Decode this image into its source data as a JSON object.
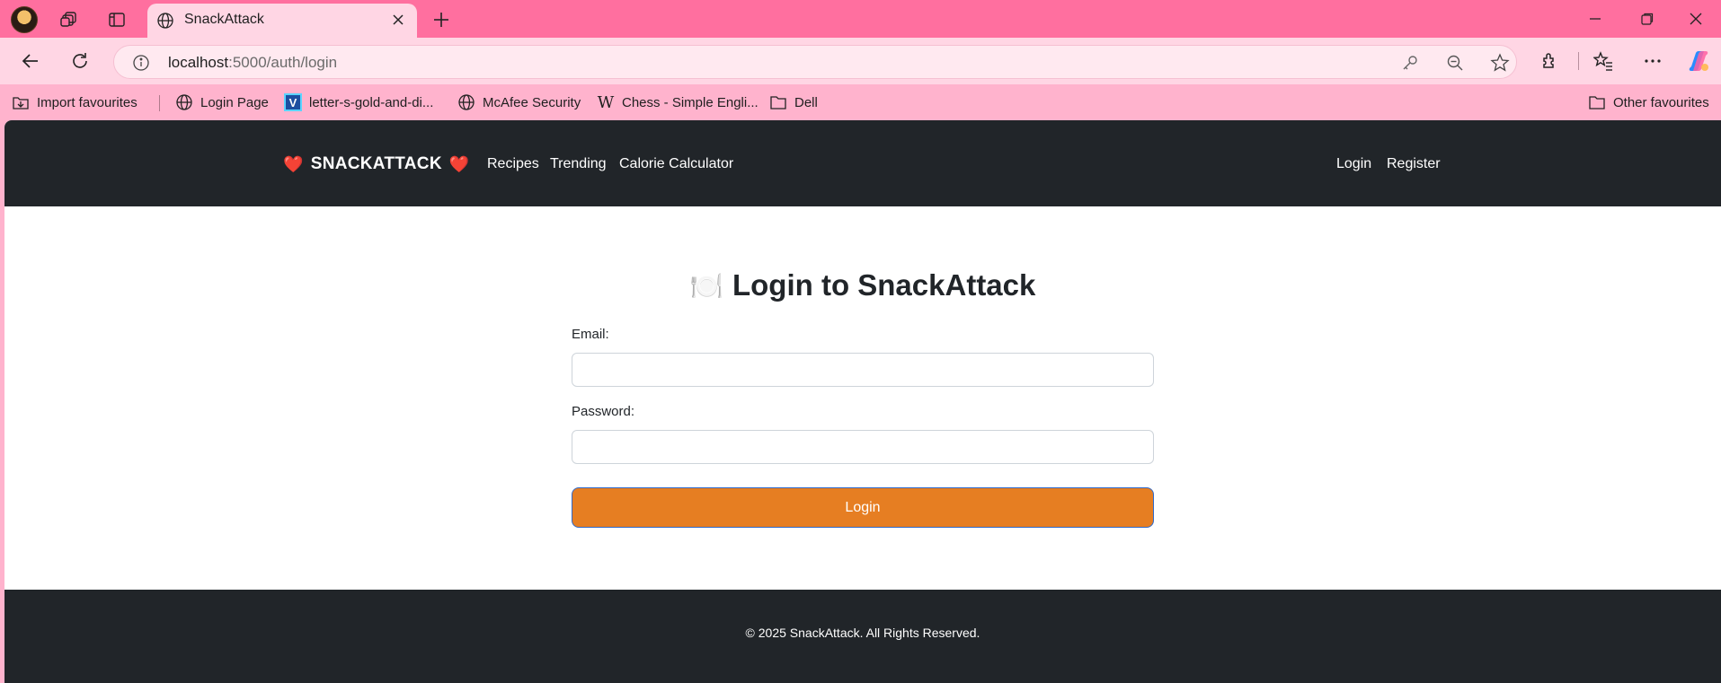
{
  "browser": {
    "tab": {
      "title": "SnackAttack"
    },
    "address": {
      "host": "localhost",
      "path": ":5000/auth/login"
    },
    "bookmarks": [
      {
        "label": "Import favourites",
        "icon": "import-icon"
      },
      {
        "label": "Login Page",
        "icon": "globe-icon"
      },
      {
        "label": "letter-s-gold-and-di...",
        "icon": "v-logo-icon"
      },
      {
        "label": "McAfee Security",
        "icon": "globe-icon"
      },
      {
        "label": "Chess - Simple Engli...",
        "icon": "wikipedia-icon"
      },
      {
        "label": "Dell",
        "icon": "folder-icon"
      }
    ],
    "other_favourites": "Other favourites",
    "colors": {
      "tabbar": "#ff6f9f",
      "toolbar": "#ffd6e4",
      "bookmarks": "#ffb3cd"
    }
  },
  "site": {
    "brand": "SNACKATTACK",
    "brand_left_icon": "❤️",
    "brand_right_icon": "❤️",
    "nav": [
      "Recipes",
      "Trending",
      "Calorie Calculator"
    ],
    "auth_nav": [
      "Login",
      "Register"
    ],
    "heading_icon": "🍽️",
    "heading": "Login to SnackAttack",
    "form": {
      "email_label": "Email:",
      "email_value": "",
      "password_label": "Password:",
      "password_value": "",
      "submit_label": "Login"
    },
    "footer": "© 2025 SnackAttack. All Rights Reserved.",
    "colors": {
      "header": "#212529",
      "button": "#e67e22",
      "footer": "#212529"
    }
  }
}
